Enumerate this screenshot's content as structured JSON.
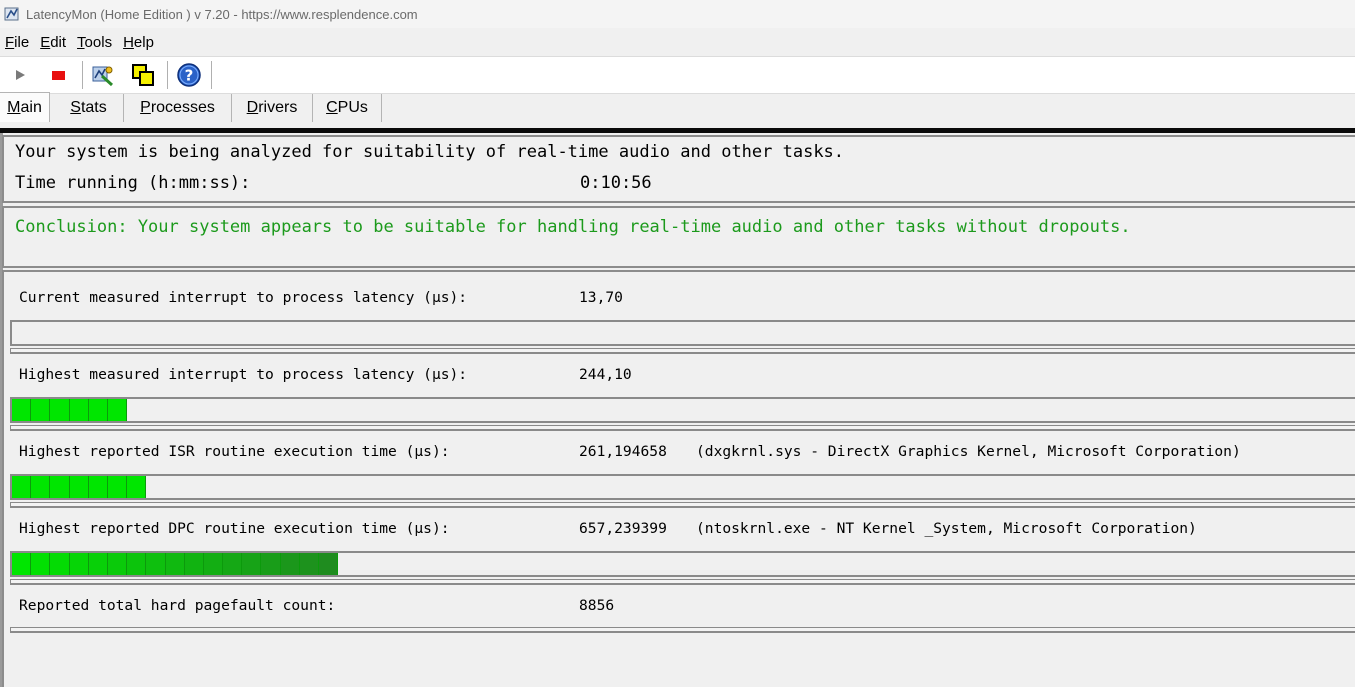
{
  "window": {
    "title": "LatencyMon  (Home Edition )  v 7.20 - https://www.resplendence.com"
  },
  "menu": [
    {
      "label": "File",
      "accel": "F",
      "rest": "ile"
    },
    {
      "label": "Edit",
      "accel": "E",
      "rest": "dit"
    },
    {
      "label": "Tools",
      "accel": "T",
      "rest": "ools"
    },
    {
      "label": "Help",
      "accel": "H",
      "rest": "elp"
    }
  ],
  "toolbar": {
    "icons": [
      "play-icon",
      "stop-icon",
      "analyze-icon",
      "windows-icon",
      "help-icon"
    ]
  },
  "tabs": [
    {
      "label": "Main",
      "accel": "M",
      "rest": "ain",
      "active": true
    },
    {
      "label": "Stats",
      "accel": "S",
      "rest": "tats",
      "active": false
    },
    {
      "label": "Processes",
      "accel": "P",
      "rest": "rocesses",
      "active": false
    },
    {
      "label": "Drivers",
      "accel": "D",
      "rest": "rivers",
      "active": false
    },
    {
      "label": "CPUs",
      "accel": "C",
      "rest": "PUs",
      "active": false
    }
  ],
  "status": {
    "analyzing": "Your system is being analyzed for suitability of real-time audio and other tasks.",
    "time_label": "Time running (h:mm:ss):",
    "time_value": "0:10:56"
  },
  "conclusion": "Conclusion: Your system appears to be suitable for handling real-time audio and other tasks without dropouts.",
  "metrics": [
    {
      "label": "Current measured interrupt to process latency (µs):",
      "value": "13,70",
      "detail": "",
      "bar_segments": 0,
      "has_bar": true
    },
    {
      "label": "Highest measured interrupt to process latency (µs):",
      "value": "244,10",
      "detail": "",
      "bar_segments": 6,
      "has_bar": true
    },
    {
      "label": "Highest reported ISR routine execution time (µs):",
      "value": "261,194658",
      "detail": "(dxgkrnl.sys - DirectX Graphics Kernel, Microsoft Corporation)",
      "bar_segments": 7,
      "has_bar": true
    },
    {
      "label": "Highest reported DPC routine execution time (µs):",
      "value": "657,239399",
      "detail": "(ntoskrnl.exe - NT Kernel _System, Microsoft Corporation)",
      "bar_segments": 17,
      "has_bar": true
    },
    {
      "label": "Reported total hard pagefault count:",
      "value": "8856",
      "detail": "",
      "bar_segments": 0,
      "has_bar": false
    }
  ],
  "colors": {
    "conclusion_green": "#1c9a1c",
    "bar_green_light": "#00e600",
    "bar_green_dark": "#1f8c1f",
    "stop_red": "#e81010"
  }
}
